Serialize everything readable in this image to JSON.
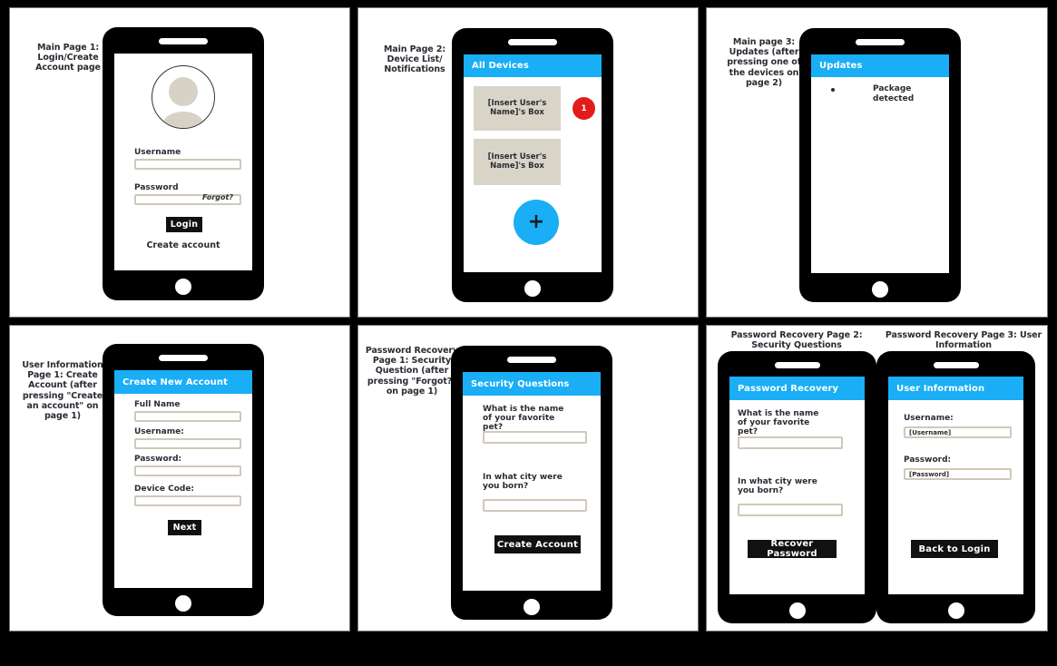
{
  "board": {
    "background_color": "#000000",
    "accent_color": "#19aef5",
    "badge_color": "#e21b1b",
    "field_border_color": "#cfc9b8",
    "box_fill_color": "#d8d5c8",
    "text_color": "#2b2b33"
  },
  "panels": [
    {
      "id": "panel-1",
      "caption": "Main Page 1: Login/Create Account page",
      "screen": {
        "avatar_icon": "user-avatar-icon",
        "username_label": "Username",
        "username_value": "",
        "password_label": "Password",
        "password_value": "",
        "forgot_link": "Forgot?",
        "login_button": "Login",
        "create_account_link": "Create account"
      }
    },
    {
      "id": "panel-2",
      "caption": "Main Page 2: Device List/ Notifications",
      "screen": {
        "title": "All Devices",
        "devices": [
          {
            "label": "[Insert User's Name]'s Box",
            "badge": "1"
          },
          {
            "label": "[Insert User's Name]'s Box",
            "badge": ""
          }
        ],
        "add_button": "+"
      }
    },
    {
      "id": "panel-3",
      "caption": "Main page 3: Updates (after pressing one of the devices on page 2)",
      "screen": {
        "title": "Updates",
        "updates": [
          "Package detected"
        ]
      }
    },
    {
      "id": "panel-4",
      "caption": "User Information Page 1: Create Account (after pressing \"Create an account\" on page 1)",
      "screen": {
        "title": "Create New Account",
        "fields": [
          {
            "label": "Full Name",
            "value": ""
          },
          {
            "label": "Username:",
            "value": ""
          },
          {
            "label": "Password:",
            "value": ""
          },
          {
            "label": "Device Code:",
            "value": ""
          }
        ],
        "next_button": "Next"
      }
    },
    {
      "id": "panel-5",
      "caption": "Password Recovery Page 1: Security Question (after pressing \"Forgot?\" on page 1)",
      "screen": {
        "title": "Security Questions",
        "questions": [
          {
            "label": "What is the name of your favorite pet?",
            "value": ""
          },
          {
            "label": "In what city were you born?",
            "value": ""
          }
        ],
        "submit_button": "Create Account"
      }
    },
    {
      "id": "panel-6",
      "left_caption": "Password Recovery Page 2: Security Questions",
      "right_caption": "Password Recovery Page 3: User Information",
      "left_screen": {
        "title": "Password Recovery",
        "questions": [
          {
            "label": "What is the name of your favorite pet?",
            "value": ""
          },
          {
            "label": "In what city were you born?",
            "value": ""
          }
        ],
        "submit_button": "Recover Password"
      },
      "right_screen": {
        "title": "User Information",
        "fields": [
          {
            "label": "Username:",
            "value": "[Username]"
          },
          {
            "label": "Password:",
            "value": "[Password]"
          }
        ],
        "submit_button": "Back to Login"
      }
    }
  ]
}
